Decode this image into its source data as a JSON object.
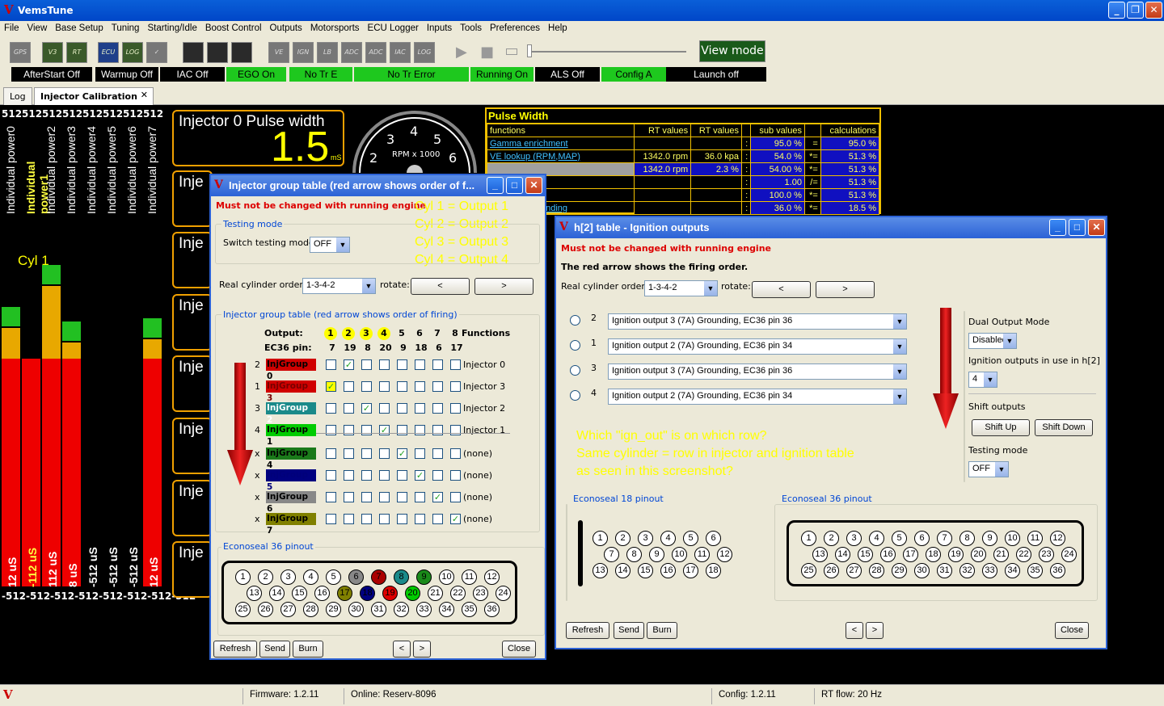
{
  "app": {
    "title": "VemsTune"
  },
  "menu": [
    "File",
    "View",
    "Base Setup",
    "Tuning",
    "Starting/Idle",
    "Boost Control",
    "Outputs",
    "Motorsports",
    "ECU Logger",
    "Inputs",
    "Tools",
    "Preferences",
    "Help"
  ],
  "toolbar": {
    "view_mode": "View mode",
    "icons": [
      "GPS",
      "V3",
      "RT",
      "ECU",
      "LOG",
      "✓",
      "",
      "",
      "",
      "VE",
      "IGN",
      "LB",
      "ADC",
      "ADC",
      "IAC",
      "LOG",
      "▶",
      "■"
    ]
  },
  "status_indicators": [
    {
      "label": "AfterStart Off",
      "state": "off"
    },
    {
      "label": "Warmup Off",
      "state": "off"
    },
    {
      "label": "IAC Off",
      "state": "off"
    },
    {
      "label": "EGO On",
      "state": "on"
    },
    {
      "label": "No Tr E",
      "state": "on"
    },
    {
      "label": "No Tr Error",
      "state": "on"
    },
    {
      "label": "Running On",
      "state": "on"
    },
    {
      "label": "ALS Off",
      "state": "off"
    },
    {
      "label": "Config A",
      "state": "on"
    },
    {
      "label": "Launch off",
      "state": "off"
    }
  ],
  "tabs": [
    "Log",
    "Injector Calibration"
  ],
  "bars": {
    "top_values": [
      "512",
      "512",
      "512",
      "512",
      "512",
      "512",
      "512",
      "512"
    ],
    "labels": [
      "Individual power0",
      "Individual power1",
      "Individual power2",
      "Individual power3",
      "Individual power4",
      "Individual power5",
      "Individual power6",
      "Individual power7"
    ],
    "bottom_values": [
      "12 uS",
      "-112 uS",
      "112 uS",
      "8 uS",
      "-512 uS",
      "-512 uS",
      "-512 uS",
      "12 uS"
    ],
    "axis": "-512-512-512-512-512-512-512-512",
    "cyl_label": "Cyl 1",
    "colors": {
      "yellow": "#e8a800",
      "red": "#ee0000",
      "green": "#22c022"
    }
  },
  "gauge": {
    "title": "Injector 0 Pulse width",
    "value": "1.5",
    "unit": "mS",
    "stub": "Inje"
  },
  "rpm": {
    "label": "RPM x 1000",
    "ticks": [
      "2",
      "3",
      "4",
      "5",
      "6"
    ]
  },
  "pulse_width": {
    "title": "Pulse Width",
    "headers": [
      "functions",
      "RT values",
      "RT values",
      "",
      "sub values",
      "",
      "calculations"
    ],
    "rows": [
      [
        "Gamma enrichment",
        "",
        "",
        ":",
        "95.0 %",
        "=",
        "95.0 %"
      ],
      [
        "VE lookup (RPM,MAP)",
        "1342.0 rpm",
        "36.0 kpa",
        ":",
        "54.0 %",
        "*=",
        "51.3 %"
      ],
      [
        "",
        "1342.0 rpm",
        "2.3 %",
        ":",
        "54.00 %",
        "*=",
        "51.3 %"
      ],
      [
        "",
        "",
        "",
        ":",
        "1.00",
        "/=",
        "51.3 %"
      ],
      [
        "ion",
        "",
        "",
        ":",
        "100.0 %",
        "*=",
        "51.3 %"
      ],
      [
        "ed density Blending",
        "",
        "",
        ":",
        "36.0 %",
        "*=",
        "18.5 %"
      ]
    ]
  },
  "inj_dialog": {
    "title": "Injector group table (red arrow shows order of f...",
    "warning": "Must not be changed with running engine",
    "testing_group": "Testing mode",
    "switch_label": "Switch testing mode",
    "switch_value": "OFF",
    "real_order_label": "Real cylinder order:",
    "real_order_value": "1-3-4-2",
    "rotate_label": "rotate:",
    "prev": "<",
    "next": ">",
    "table_group": "Injector group table (red arrow shows order of firing)",
    "output_label": "Output:",
    "outputs": [
      "1",
      "2",
      "3",
      "4",
      "5",
      "6",
      "7",
      "8"
    ],
    "functions_label": "Functions",
    "ec36_label": "EC36 pin:",
    "pins": [
      "7",
      "19",
      "8",
      "20",
      "9",
      "18",
      "6",
      "17"
    ],
    "rows": [
      {
        "num": "2",
        "group": "InjGroup 0",
        "color": "#d00000",
        "text": "#000",
        "checked": 1,
        "func": "Injector 0"
      },
      {
        "num": "1",
        "group": "InjGroup 3",
        "color": "#d00000",
        "text": "#700",
        "checked": 0,
        "func": "Injector 3"
      },
      {
        "num": "3",
        "group": "InjGroup 2",
        "color": "#1a8a8a",
        "text": "#fff",
        "checked": 2,
        "func": "Injector 2"
      },
      {
        "num": "4",
        "group": "InjGroup 1",
        "color": "#00cc00",
        "text": "#000",
        "checked": 3,
        "func": "Injector 1"
      },
      {
        "num": "x",
        "group": "InjGroup 4",
        "color": "#1a7a1a",
        "text": "#000",
        "checked": 4,
        "func": "(none)"
      },
      {
        "num": "x",
        "group": "InjGroup 5",
        "color": "#000080",
        "text": "#00007a",
        "checked": 5,
        "func": "(none)"
      },
      {
        "num": "x",
        "group": "InjGroup 6",
        "color": "#888888",
        "text": "#000",
        "checked": 6,
        "func": "(none)"
      },
      {
        "num": "x",
        "group": "InjGroup 7",
        "color": "#808000",
        "text": "#000",
        "checked": 7,
        "func": "(none)"
      }
    ],
    "econoseal_label": "Econoseal 36 pinout",
    "pins36": [
      [
        "1",
        "2",
        "3",
        "4",
        "5",
        "6",
        "7",
        "8",
        "9",
        "10",
        "11",
        "12"
      ],
      [
        "13",
        "14",
        "15",
        "16",
        "17",
        "18",
        "19",
        "20",
        "21",
        "22",
        "23",
        "24"
      ],
      [
        "25",
        "26",
        "27",
        "28",
        "29",
        "30",
        "31",
        "32",
        "33",
        "34",
        "35",
        "36"
      ]
    ],
    "pin_colors": {
      "6": "#888888",
      "7": "#aa0000",
      "8": "#1a8a8a",
      "9": "#1a8a1a",
      "17": "#808000",
      "18": "#000080",
      "19": "#dd0000",
      "20": "#00cc00"
    },
    "buttons": {
      "refresh": "Refresh",
      "send": "Send",
      "burn": "Burn",
      "close": "Close"
    },
    "annotation": [
      "Cyl 1 = Output 1",
      "Cyl 2 = Output 2",
      "Cyl 3 = Output 3",
      "Cyl 4 = Output 4"
    ]
  },
  "ign_dialog": {
    "title": "h[2] table - Ignition outputs",
    "warning": "Must not be changed with running engine",
    "firing_note": "The red arrow shows the firing order.",
    "real_order_label": "Real cylinder order:",
    "real_order_value": "1-3-4-2",
    "rotate_label": "rotate:",
    "rows": [
      {
        "num": "2",
        "value": "Ignition output 3 (7A) Grounding, EC36 pin 36"
      },
      {
        "num": "1",
        "value": "Ignition output 2 (7A) Grounding, EC36 pin 34"
      },
      {
        "num": "3",
        "value": "Ignition output 3 (7A) Grounding, EC36 pin 36"
      },
      {
        "num": "4",
        "value": "Ignition output 2 (7A) Grounding, EC36 pin 34"
      }
    ],
    "dual_label": "Dual Output Mode",
    "dual_value": "Disabled",
    "in_use_label": "Ignition outputs in use in h[2]",
    "in_use_value": "4",
    "shift_label": "Shift outputs",
    "shift_up": "Shift Up",
    "shift_down": "Shift Down",
    "testing_label": "Testing mode",
    "testing_value": "OFF",
    "annotation": [
      "Which \"ign_out\" is on which row?",
      "Same cylinder = row in injector and ignition  table",
      "as seen in this screenshot?"
    ],
    "econoseal18_label": "Econoseal 18 pinout",
    "econoseal36_label": "Econoseal 36 pinout",
    "pins18": [
      [
        "1",
        "2",
        "3",
        "4",
        "5",
        "6"
      ],
      [
        "7",
        "8",
        "9",
        "10",
        "11",
        "12"
      ],
      [
        "13",
        "14",
        "15",
        "16",
        "17",
        "18"
      ]
    ]
  },
  "bottom_status": {
    "firmware": "Firmware: 1.2.11",
    "online": "Online: Reserv-8096",
    "config": "Config: 1.2.11",
    "rt_flow": "RT flow: 20 Hz"
  }
}
